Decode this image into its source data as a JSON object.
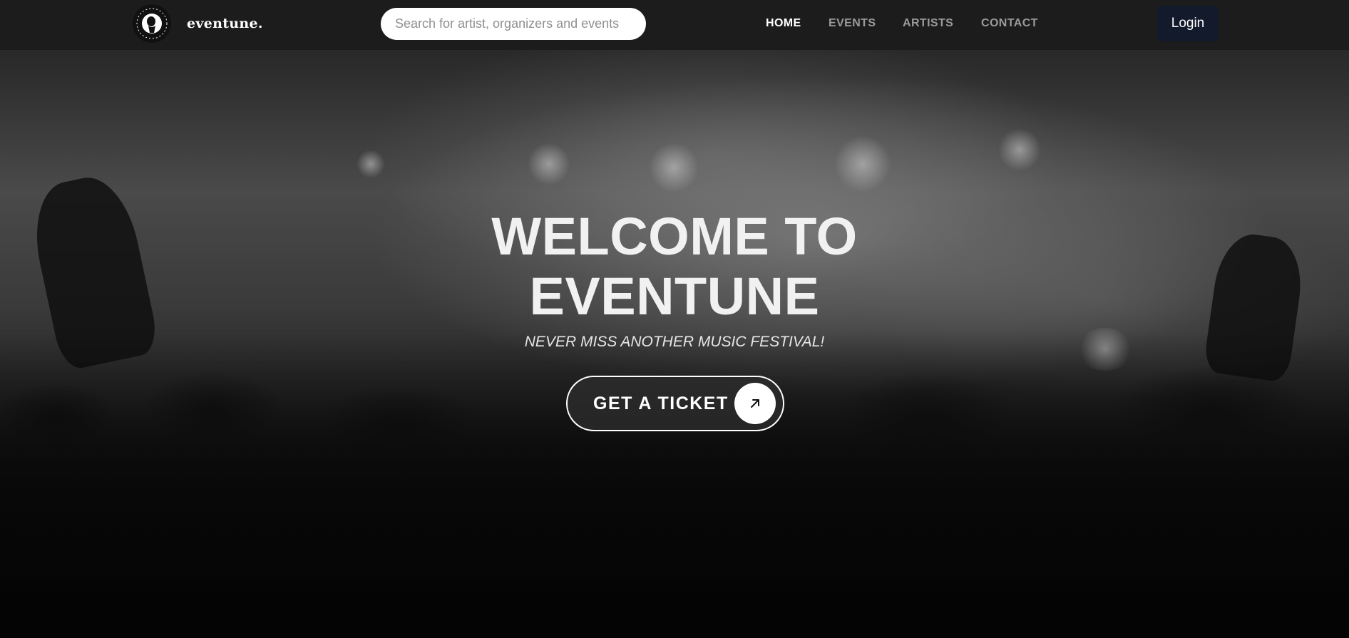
{
  "brand": {
    "name": "eventune.",
    "logo_icon": "eventune-circular-logo-icon",
    "logo_ring_text": "eventune · eventune ·"
  },
  "search": {
    "placeholder": "Search for artist, organizers and events",
    "value": ""
  },
  "nav": {
    "items": [
      {
        "label": "HOME",
        "active": true
      },
      {
        "label": "EVENTS",
        "active": false
      },
      {
        "label": "ARTISTS",
        "active": false
      },
      {
        "label": "CONTACT",
        "active": false
      }
    ],
    "login_label": "Login"
  },
  "hero": {
    "title_line1": "WELCOME TO",
    "title_line2": "EVENTUNE",
    "subtitle": "NEVER MISS ANOTHER MUSIC FESTIVAL!",
    "cta_label": "GET A TICKET",
    "cta_icon": "arrow-up-right-icon",
    "background": "grayscale-concert-crowd-image"
  },
  "colors": {
    "navbar_bg": "#1c1c1c",
    "login_bg": "#121a2c",
    "nav_active": "#ffffff",
    "nav_inactive": "#9a9a9a",
    "title_text": "#f1f1f1"
  }
}
